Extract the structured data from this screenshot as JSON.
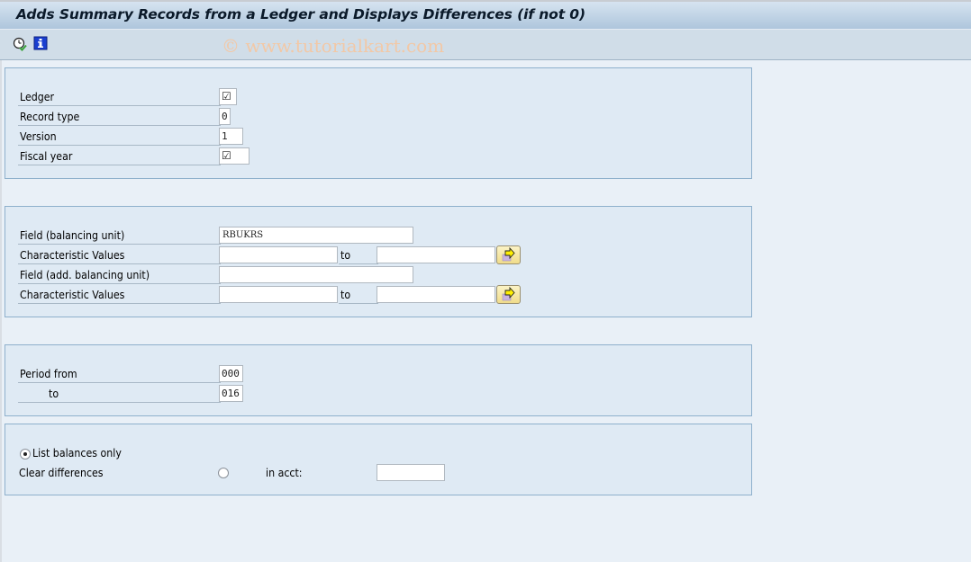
{
  "window": {
    "title": "Adds Summary Records from a Ledger and Displays Differences (if not 0)"
  },
  "toolbar": {
    "execute_icon": "clock-check-icon",
    "info_icon": "info-icon",
    "watermark": "© www.tutorialkart.com"
  },
  "group1": {
    "ledger": {
      "label": "Ledger",
      "value": "☑"
    },
    "record_type": {
      "label": "Record type",
      "value": "0"
    },
    "version": {
      "label": "Version",
      "value": "1"
    },
    "fiscal_year": {
      "label": "Fiscal year",
      "value": "☑"
    }
  },
  "group2": {
    "field_balancing_unit": {
      "label": "Field (balancing unit)",
      "value": "RBUKRS"
    },
    "char_values_1": {
      "label": "Characteristic Values",
      "from": "",
      "to_label": "to",
      "to": ""
    },
    "field_add_balancing_unit": {
      "label": "Field (add. balancing unit)",
      "value": ""
    },
    "char_values_2": {
      "label": "Characteristic Values",
      "from": "",
      "to_label": "to",
      "to": ""
    },
    "multiple_selection_icon": "multiple-selection-arrow-icon"
  },
  "group3": {
    "period_from": {
      "label": "Period from",
      "value": "000"
    },
    "period_to": {
      "label": "to",
      "value": "016"
    }
  },
  "group4": {
    "list_balances_only": {
      "label": "List balances only",
      "selected": true
    },
    "clear_differences": {
      "label": "Clear differences",
      "selected": false
    },
    "in_acct": {
      "label": "in acct:",
      "value": ""
    }
  }
}
